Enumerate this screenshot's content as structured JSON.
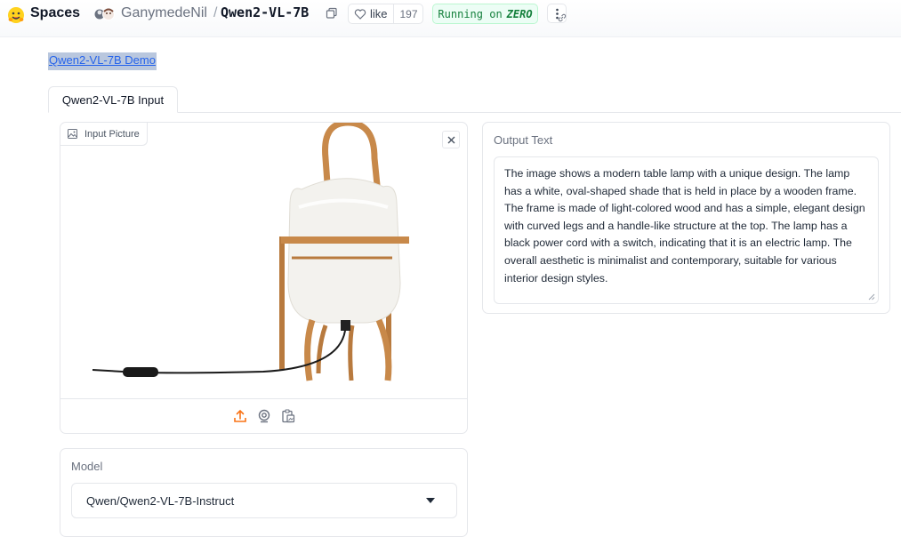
{
  "header": {
    "spaces_label": "Spaces",
    "owner": "GanymedeNil",
    "separator": "/",
    "repo_name": "Qwen2-VL-7B",
    "like_label": "like",
    "like_count": "197",
    "status_text": "Running on",
    "status_hardware": "ZERO",
    "status_color": "#15803d"
  },
  "demo_link_text": "Qwen2-VL-7B Demo",
  "tabs": [
    {
      "label": "Qwen2-VL-7B Input"
    }
  ],
  "image_input": {
    "label": "Input Picture",
    "image_icon": "lamp-photo",
    "toolbar": [
      "upload-icon",
      "webcam-icon",
      "clipboard-icon"
    ],
    "accent_color": "#f97316"
  },
  "output": {
    "label": "Output Text",
    "text": "The image shows a modern table lamp with a unique design. The lamp has a white, oval-shaped shade that is held in place by a wooden frame. The frame is made of light-colored wood and has a simple, elegant design with curved legs and a handle-like structure at the top. The lamp has a black power cord with a switch, indicating that it is an electric lamp. The overall aesthetic is minimalist and contemporary, suitable for various interior design styles."
  },
  "model": {
    "label": "Model",
    "selected": "Qwen/Qwen2-VL-7B-Instruct"
  }
}
